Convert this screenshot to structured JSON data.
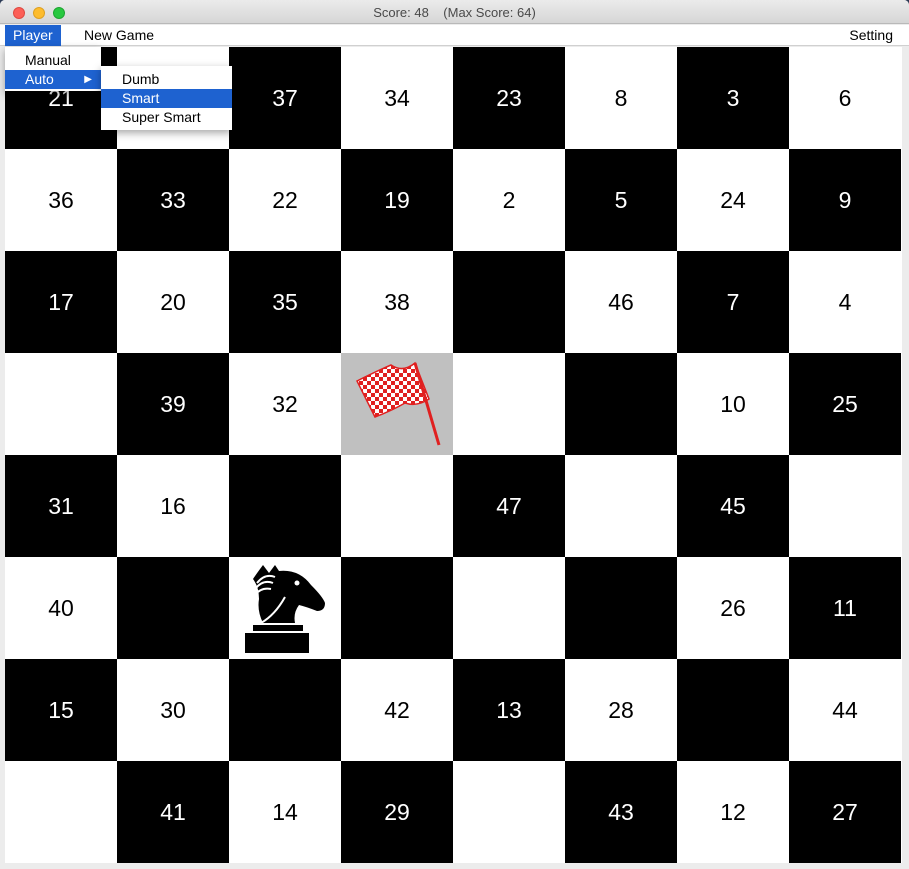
{
  "window": {
    "title": "Score: 48    (Max Score: 64)"
  },
  "menubar": {
    "player": "Player",
    "new_game": "New Game",
    "setting": "Setting"
  },
  "player_menu": {
    "manual": "Manual",
    "auto": "Auto"
  },
  "auto_submenu": {
    "dumb": "Dumb",
    "smart": "Smart",
    "super_smart": "Super Smart",
    "selected": "Smart"
  },
  "board": {
    "rows": [
      [
        "21",
        "",
        "37",
        "34",
        "23",
        "8",
        "3",
        "6"
      ],
      [
        "36",
        "33",
        "22",
        "19",
        "2",
        "5",
        "24",
        "9"
      ],
      [
        "17",
        "20",
        "35",
        "38",
        "",
        "46",
        "7",
        "4"
      ],
      [
        "",
        "39",
        "32",
        "",
        "",
        "",
        "10",
        "25"
      ],
      [
        "31",
        "16",
        "",
        "",
        "47",
        "",
        "45",
        ""
      ],
      [
        "40",
        "",
        "",
        "",
        "",
        "",
        "26",
        "11"
      ],
      [
        "15",
        "30",
        "",
        "42",
        "13",
        "28",
        "",
        "44"
      ],
      [
        "",
        "41",
        "14",
        "29",
        "",
        "43",
        "12",
        "27"
      ]
    ],
    "knight": {
      "row": 5,
      "col": 2,
      "icon": "knight-icon"
    },
    "goal": {
      "row": 3,
      "col": 3,
      "icon": "checkered-flag-icon"
    },
    "colors": {
      "dark": "#000000",
      "light": "#ffffff",
      "goal": "#c0c0c0",
      "flag": "#e02020",
      "highlight": "#1e62d0"
    }
  }
}
